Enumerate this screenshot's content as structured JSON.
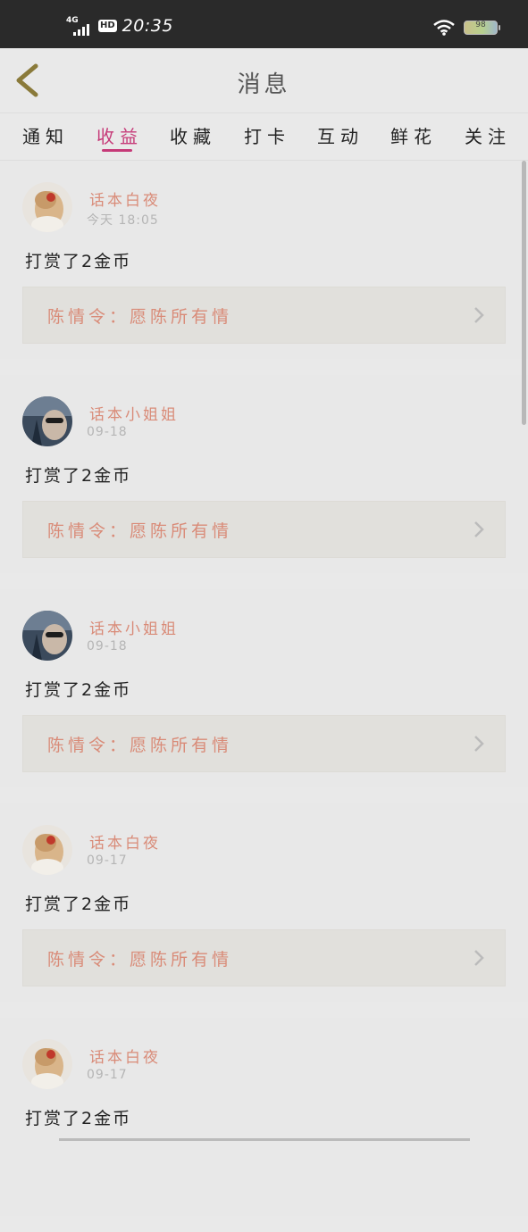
{
  "status": {
    "net": "4G",
    "hd": "HD",
    "time": "20:35",
    "battery": "98"
  },
  "header": {
    "title": "消息"
  },
  "tabs": [
    {
      "label": "通知",
      "active": false
    },
    {
      "label": "收益",
      "active": true
    },
    {
      "label": "收藏",
      "active": false
    },
    {
      "label": "打卡",
      "active": false
    },
    {
      "label": "互动",
      "active": false
    },
    {
      "label": "鲜花",
      "active": false
    },
    {
      "label": "关注",
      "active": false
    }
  ],
  "items": [
    {
      "user": "话本白夜",
      "time": "今天 18:05",
      "action": "打赏了2金币",
      "work": "陈情令：愿陈所有情"
    },
    {
      "user": "话本小姐姐",
      "time": "09-18",
      "action": "打赏了2金币",
      "work": "陈情令：愿陈所有情"
    },
    {
      "user": "话本小姐姐",
      "time": "09-18",
      "action": "打赏了2金币",
      "work": "陈情令：愿陈所有情"
    },
    {
      "user": "话本白夜",
      "time": "09-17",
      "action": "打赏了2金币",
      "work": "陈情令：愿陈所有情"
    },
    {
      "user": "话本白夜",
      "time": "09-17",
      "action": "打赏了2金币",
      "work": ""
    }
  ],
  "colors": {
    "accent": "#c63a78",
    "name": "#d98b78",
    "statusbar": "#2a2a2a"
  },
  "icons": {
    "back": "back-chevron-icon",
    "row": "chevron-right-icon",
    "wifi": "wifi-icon",
    "battery": "battery-icon"
  }
}
